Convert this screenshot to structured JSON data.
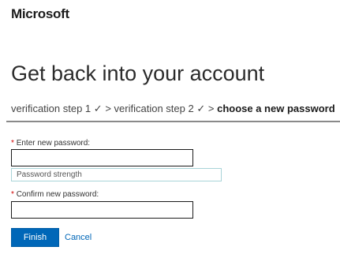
{
  "header": {
    "logo_text": "Microsoft"
  },
  "page": {
    "title": "Get back into your account"
  },
  "breadcrumb": {
    "step1": "verification step 1",
    "step1_check": "✓",
    "separator1": ">",
    "step2": "verification step 2",
    "step2_check": "✓",
    "separator2": ">",
    "current": "choose a new password"
  },
  "form": {
    "required_marker": "*",
    "new_password_label": "Enter new password:",
    "new_password_value": "",
    "strength_text": "Password strength",
    "confirm_password_label": "Confirm new password:",
    "confirm_password_value": "",
    "finish_label": "Finish",
    "cancel_label": "Cancel"
  },
  "colors": {
    "accent": "#0067b8",
    "required": "#d00000",
    "strength_border": "#a9d4d8"
  }
}
